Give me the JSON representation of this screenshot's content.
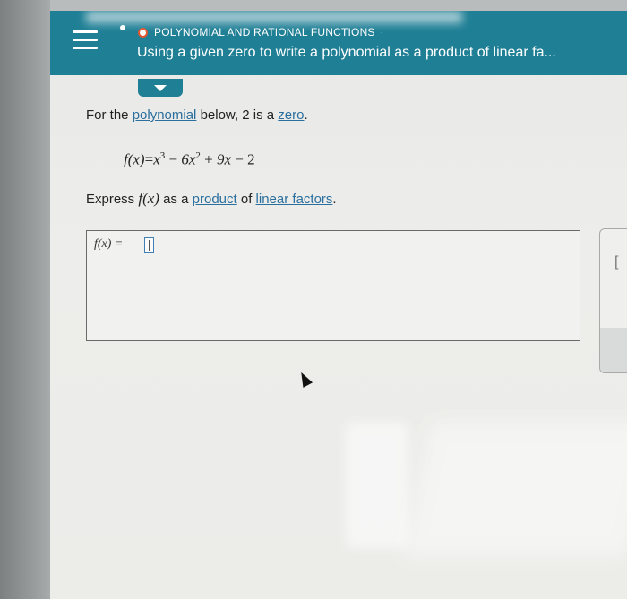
{
  "header": {
    "topic": "POLYNOMIAL AND RATIONAL FUNCTIONS",
    "title": "Using a given zero to write a polynomial as a product of linear fa..."
  },
  "question": {
    "prefix": "For the ",
    "link1": "polynomial",
    "middle": " below, 2 is a ",
    "link2": "zero",
    "suffix": "."
  },
  "equation": {
    "lhs": "f(x)",
    "eq": "=",
    "t1_base": "x",
    "t1_exp": "3",
    "op1": " − ",
    "t2_base": "6x",
    "t2_exp": "2",
    "op2": " + ",
    "t3": "9x",
    "op3": " − ",
    "t4": "2"
  },
  "instruction": {
    "prefix": "Express ",
    "fx": "f(x)",
    "middle": " as a ",
    "link1": "product",
    "of": " of ",
    "link2": "linear factors",
    "suffix": "."
  },
  "answer": {
    "label": "f(x) ="
  },
  "side_panel": {
    "bracket": "["
  },
  "colors": {
    "header_bg": "#1f7f95",
    "link": "#2a6f9e",
    "status_ring": "#e1532e",
    "input_border": "#3f7fb3"
  }
}
